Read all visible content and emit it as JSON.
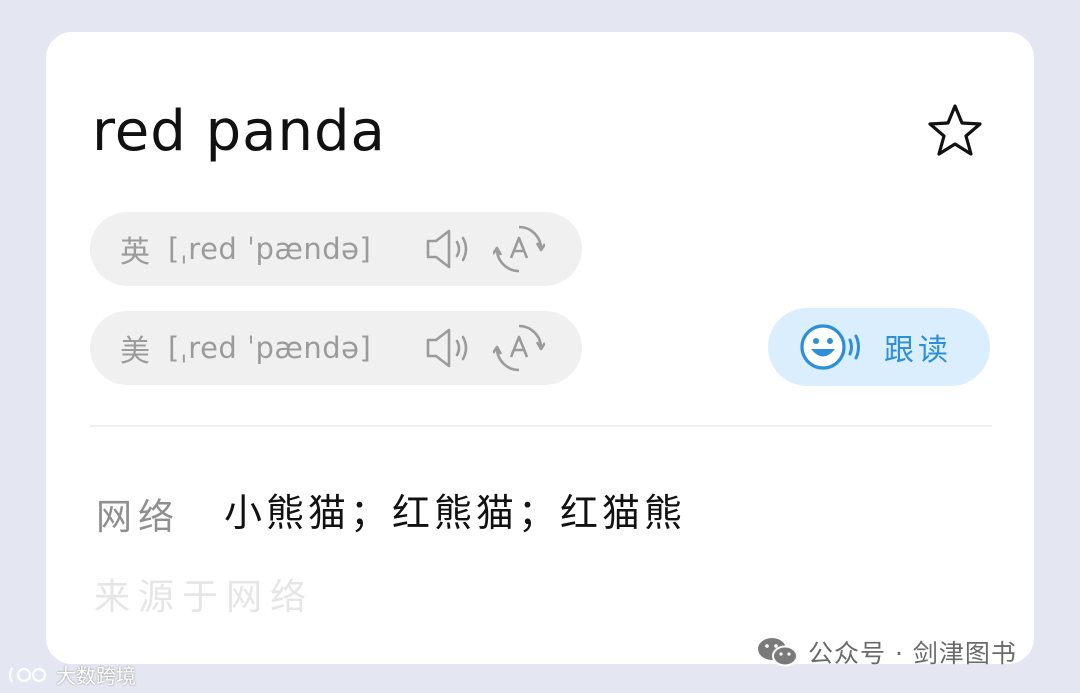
{
  "entry": {
    "word": "red panda"
  },
  "pronunciations": [
    {
      "region": "英",
      "ipa": "[ˌred ˈpændə]"
    },
    {
      "region": "美",
      "ipa": "[ˌred ˈpændə]"
    }
  ],
  "follow_read": {
    "label": "跟读"
  },
  "definition": {
    "tag": "网络",
    "text": "小熊猫；红熊猫；红猫熊",
    "source": "来源于网络"
  },
  "watermarks": {
    "right": "公众号 · 剑津图书",
    "left": "大数跨境"
  },
  "icons": {
    "favorite": "star-icon",
    "speaker": "speaker-icon",
    "auto": "auto-play-icon",
    "follow": "smiley-voice-icon"
  },
  "colors": {
    "background": "#e4e7f1",
    "card": "#ffffff",
    "pill": "#f0f0f0",
    "accent": "#2d8fd6",
    "accent_bg": "#dbeefd"
  }
}
